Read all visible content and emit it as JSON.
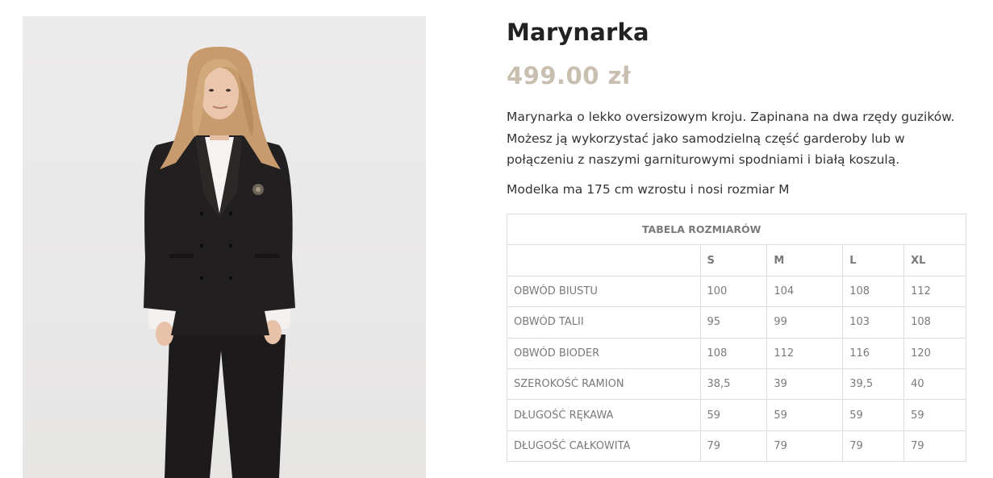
{
  "product": {
    "title": "Marynarka",
    "price": "499.00 zł",
    "description": "Marynarka o lekko oversizowym kroju. Zapinana na dwa rzędy guzików. Możesz ją wykorzystać jako samodzielną część garderoby lub w połączeniu z naszymi garniturowymi spodniami i białą koszulą.",
    "model_info": "Modelka ma 175 cm wzrostu i nosi rozmiar M"
  },
  "size_table": {
    "caption": "TABELA ROZMIARÓW",
    "sizes": [
      "S",
      "M",
      "L",
      "XL"
    ],
    "rows": [
      {
        "label": "OBWÓD BIUSTU",
        "values": [
          "100",
          "104",
          "108",
          "112"
        ]
      },
      {
        "label": "OBWÓD TALII",
        "values": [
          "95",
          "99",
          "103",
          "108"
        ]
      },
      {
        "label": "OBWÓD BIODER",
        "values": [
          "108",
          "112",
          "116",
          "120"
        ]
      },
      {
        "label": "SZEROKOŚĆ RAMION",
        "values": [
          "38,5",
          "39",
          "39,5",
          "40"
        ]
      },
      {
        "label": "DŁUGOŚĆ RĘKAWA",
        "values": [
          "59",
          "59",
          "59",
          "59"
        ]
      },
      {
        "label": "DŁUGOŚĆ CAŁKOWITA",
        "values": [
          "79",
          "79",
          "79",
          "79"
        ]
      }
    ]
  },
  "colors": {
    "price": "#c9bfb1",
    "title": "#222222",
    "table_text": "#7a7a7a",
    "table_border": "#dcdcdc"
  }
}
